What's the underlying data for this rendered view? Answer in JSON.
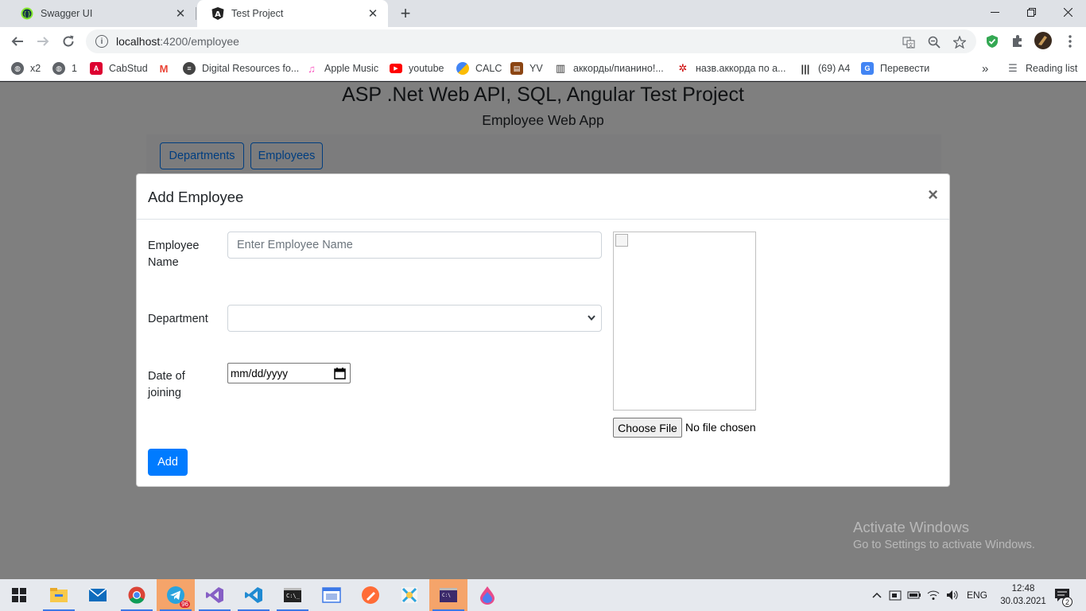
{
  "browser": {
    "tabs": [
      {
        "title": "Swagger UI",
        "icon": "swagger-icon",
        "active": false
      },
      {
        "title": "Test Project",
        "icon": "angular-icon",
        "active": true
      }
    ],
    "url_host": "localhost",
    "url_path": ":4200/employee",
    "bookmarks": [
      {
        "label": "x2",
        "icon": "globe-icon",
        "color": "#5f6368"
      },
      {
        "label": "1",
        "icon": "globe-icon",
        "color": "#5f6368"
      },
      {
        "label": "CabStud",
        "icon": "angular-icon",
        "color": "#dd0031"
      },
      {
        "label": "",
        "icon": "gmail-icon",
        "color": "#ea4335"
      },
      {
        "label": "Digital Resources fo...",
        "icon": "circle-icon",
        "color": "#444444"
      },
      {
        "label": "Apple Music",
        "icon": "music-icon",
        "color": "#fa57c1"
      },
      {
        "label": "youtube",
        "icon": "youtube-icon",
        "color": "#ff0000"
      },
      {
        "label": "CALC",
        "icon": "calc-icon",
        "color": "#4285f4"
      },
      {
        "label": "YV",
        "icon": "book-icon",
        "color": "#8b4513"
      },
      {
        "label": "аккорды/пианино!...",
        "icon": "piano-icon",
        "color": "#333333"
      },
      {
        "label": "назв.аккорда по а...",
        "icon": "gear-red-icon",
        "color": "#cc0000"
      },
      {
        "label": "(69) A4",
        "icon": "barcode-icon",
        "color": "#333333"
      },
      {
        "label": "Перевести",
        "icon": "translate-icon",
        "color": "#4285f4"
      }
    ],
    "reading_list": "Reading list",
    "more_bookmarks": "»"
  },
  "page": {
    "title": "ASP .Net Web API, SQL, Angular Test Project",
    "subtitle": "Employee Web App",
    "nav": {
      "departments": "Departments",
      "employees": "Employees"
    }
  },
  "modal": {
    "title": "Add Employee",
    "close": "×",
    "fields": {
      "name_label_1": "Employee",
      "name_label_2": "Name",
      "name_placeholder": "Enter Employee Name",
      "name_value": "",
      "department_label": "Department",
      "department_value": "",
      "date_label_1": "Date of",
      "date_label_2": "joining",
      "date_placeholder": "mm/dd/yyyy"
    },
    "file": {
      "button": "Choose File",
      "status": "No file chosen"
    },
    "add_button": "Add"
  },
  "watermark": {
    "line1": "Activate Windows",
    "line2": "Go to Settings to activate Windows."
  },
  "taskbar": {
    "language": "ENG",
    "time": "12:48",
    "date": "30.03.2021",
    "telegram_badge": "96",
    "notifications": "2"
  },
  "colors": {
    "primary": "#007bff",
    "backdrop": "rgba(0,0,0,0.5)",
    "taskbar_highlight": "#f5a46a"
  }
}
